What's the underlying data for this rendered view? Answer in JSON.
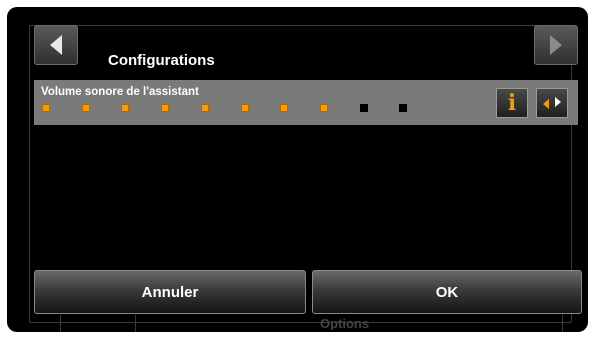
{
  "header": {
    "title": "Configurations",
    "prev_icon": "left-arrow-icon",
    "next_icon": "right-arrow-icon"
  },
  "setting": {
    "label": "Volume sonore de l'assistant",
    "level": 8,
    "max_level": 10,
    "info_icon": "info-icon",
    "adjust_icon": "left-right-arrows-icon"
  },
  "footer": {
    "cancel_label": "Annuler",
    "ok_label": "OK",
    "background_label": "Options"
  },
  "colors": {
    "accent": "#f29a10",
    "row_bg": "#7a7a7a",
    "screen_bg": "#000000"
  }
}
